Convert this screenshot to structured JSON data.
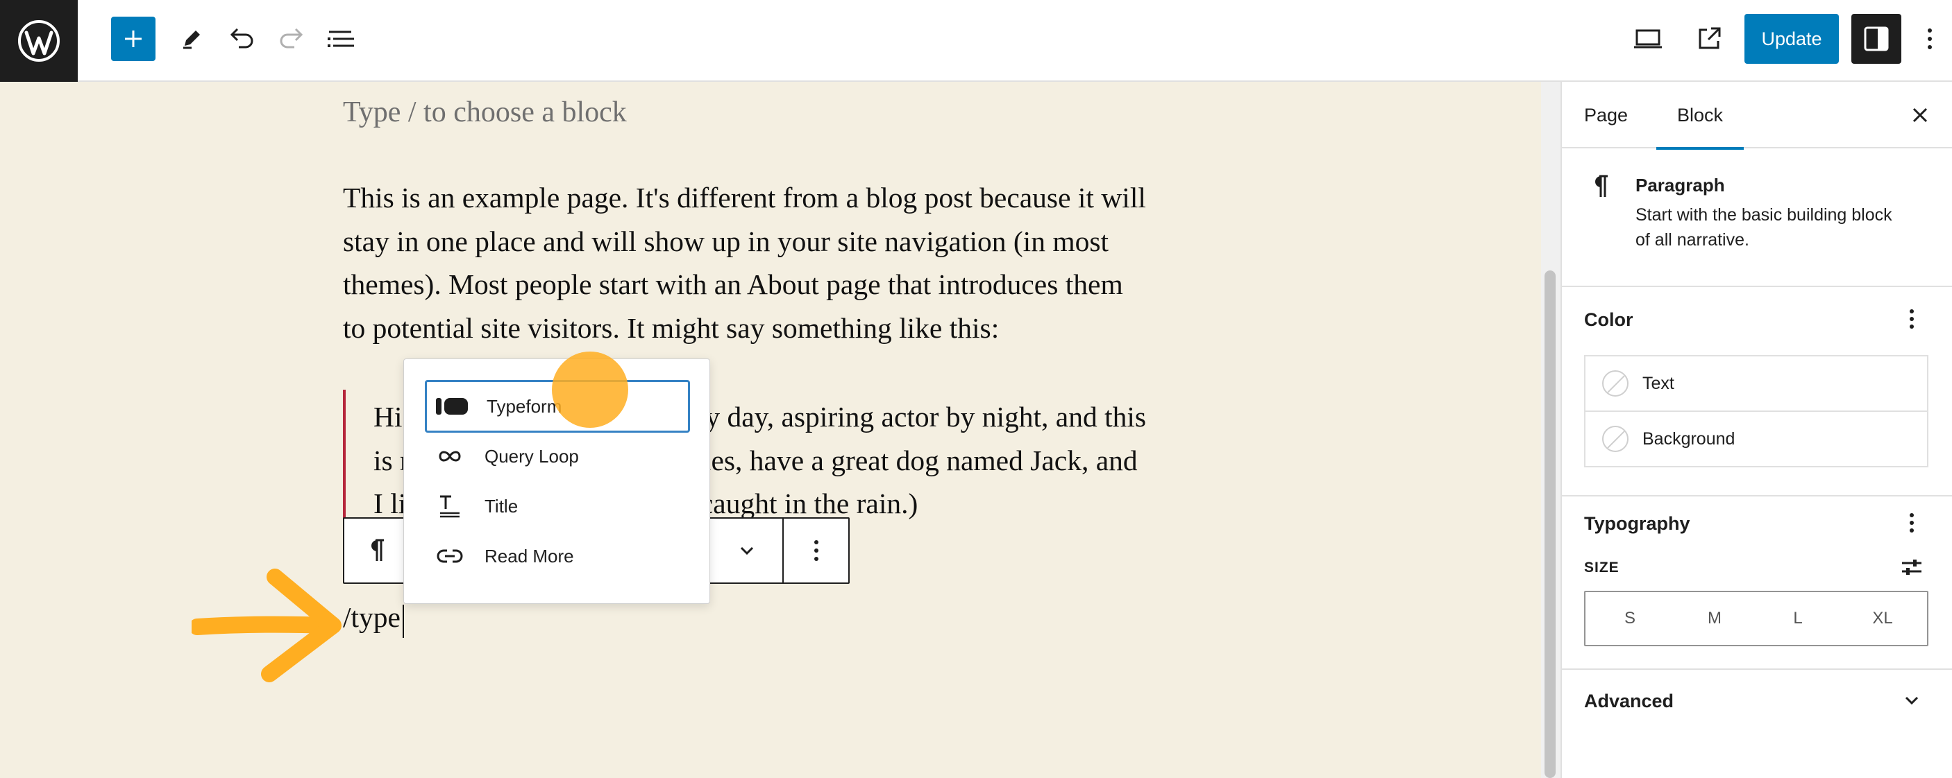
{
  "toolbar": {
    "logo_icon": "wordpress-logo-icon",
    "add_icon": "plus-icon",
    "tools_icon": "pencil-icon",
    "undo_icon": "undo-icon",
    "redo_icon": "redo-icon",
    "list_view_icon": "list-view-icon",
    "preview_icon": "desktop-preview-icon",
    "view_page_icon": "external-link-icon",
    "update_label": "Update",
    "settings_icon": "sidebar-settings-icon",
    "options_icon": "more-vertical-icon"
  },
  "editor": {
    "placeholder": "Type / to choose a block",
    "paragraph_lines": [
      "This is an example page. It's different from a blog post because it will",
      "stay in one place and will show up in your site navigation (in most",
      "themes). Most people start with an About page that introduces them",
      "to potential site visitors. It might say something like this:"
    ],
    "quote_lines": [
      "Hi                                    er by day, aspiring actor by night, and this",
      "is r                                   ngeles, have a great dog named Jack, and",
      "I li                                    in' caught in the rain.)"
    ],
    "typed_text": "/type"
  },
  "block_toolbar": {
    "block_icon": "paragraph-icon",
    "more_icon": "chevron-down-icon",
    "options_icon": "more-vertical-icon"
  },
  "inserter": {
    "items": [
      {
        "label": "Typeform",
        "icon": "typeform-icon",
        "selected": true
      },
      {
        "label": "Query Loop",
        "icon": "query-loop-icon",
        "selected": false
      },
      {
        "label": "Title",
        "icon": "title-icon",
        "selected": false
      },
      {
        "label": "Read More",
        "icon": "read-more-link-icon",
        "selected": false
      }
    ]
  },
  "sidebar": {
    "tabs": [
      "Page",
      "Block"
    ],
    "active_tab": "Block",
    "block_card": {
      "title": "Paragraph",
      "description_lines": [
        "Start with the basic building block",
        "of all narrative."
      ]
    },
    "color": {
      "heading": "Color",
      "items": [
        "Text",
        "Background"
      ]
    },
    "typography": {
      "heading": "Typography",
      "size_label": "SIZE",
      "sizes": [
        "S",
        "M",
        "L",
        "XL"
      ]
    },
    "advanced": {
      "heading": "Advanced"
    }
  },
  "colors": {
    "accent": "#007cba",
    "canvas_bg": "#f4efe1",
    "quote_bar": "#b5263b",
    "highlight": "#ffae21"
  }
}
